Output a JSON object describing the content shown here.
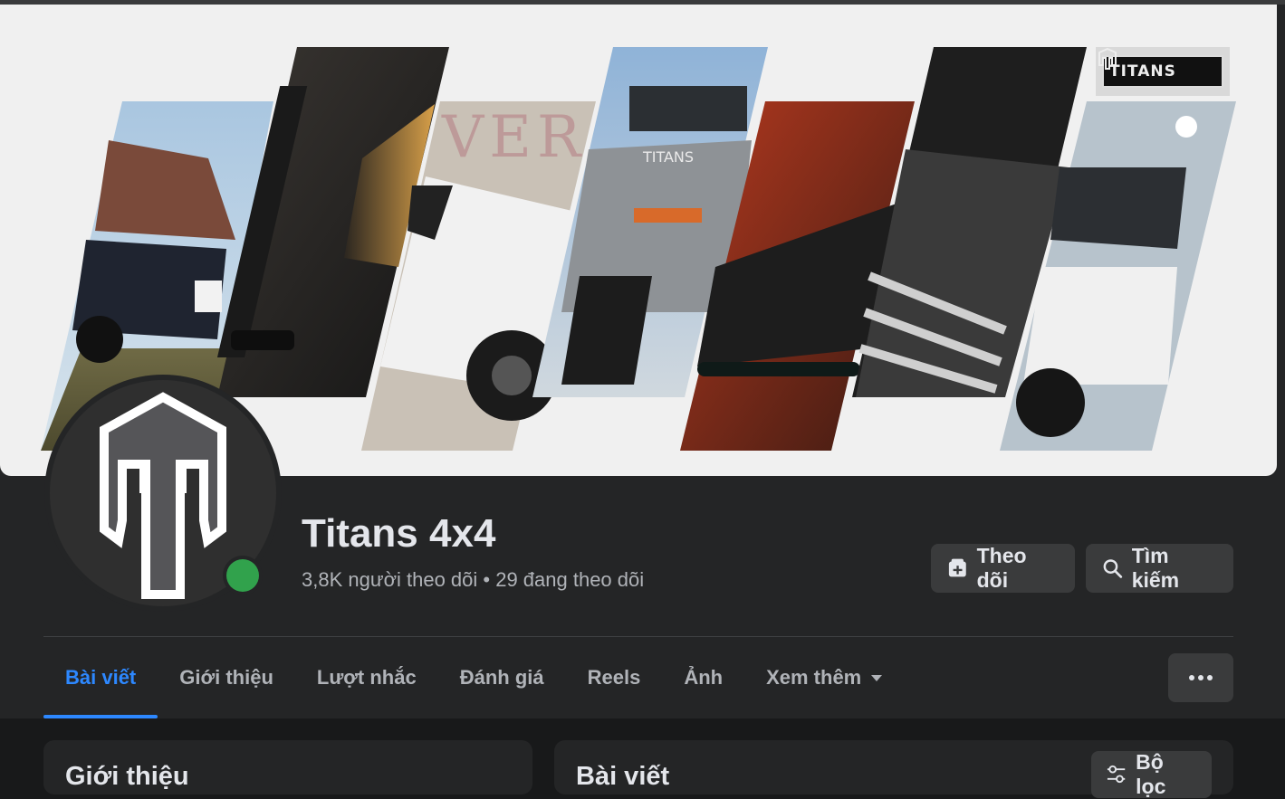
{
  "cover": {
    "logo_text": "TITANS",
    "bg_word": "VER",
    "rack_text": "TITANS"
  },
  "profile": {
    "name": "Titans 4x4",
    "stats": "3,8K người theo dõi • 29 đang theo dõi",
    "online": true
  },
  "actions": {
    "follow_label": "Theo dõi",
    "search_label": "Tìm kiếm"
  },
  "tabs": [
    {
      "label": "Bài viết",
      "active": true
    },
    {
      "label": "Giới thiệu",
      "active": false
    },
    {
      "label": "Lượt nhắc",
      "active": false
    },
    {
      "label": "Đánh giá",
      "active": false
    },
    {
      "label": "Reels",
      "active": false
    },
    {
      "label": "Ảnh",
      "active": false
    },
    {
      "label": "Xem thêm",
      "active": false
    }
  ],
  "intro_card": {
    "title": "Giới thiệu"
  },
  "posts_card": {
    "title": "Bài viết",
    "filter_label": "Bộ lọc"
  },
  "colors": {
    "accent": "#2d88ff",
    "online": "#31a24c",
    "background": "#18191a",
    "surface": "#242526"
  }
}
